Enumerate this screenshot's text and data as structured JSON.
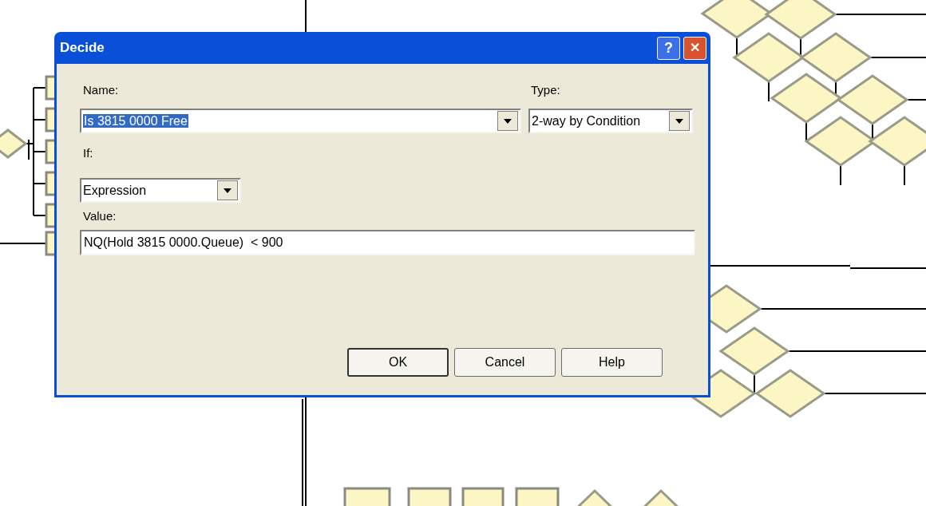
{
  "dialog": {
    "title": "Decide",
    "title_buttons": [
      {
        "kind": "help",
        "label": "?"
      },
      {
        "kind": "close",
        "label": "✕"
      }
    ]
  },
  "name": {
    "label": "Name:",
    "value": "Is 3815 0000 Free",
    "text_selected": true
  },
  "type": {
    "label": "Type:",
    "value": "2-way by Condition"
  },
  "if": {
    "label": "If:",
    "value": "Expression"
  },
  "value": {
    "label": "Value:",
    "value": "NQ(Hold 3815 0000.Queue)  < 900"
  },
  "buttons": [
    {
      "label": "OK",
      "default": true
    },
    {
      "label": "Cancel",
      "default": false
    },
    {
      "label": "Help",
      "default": false
    }
  ]
}
